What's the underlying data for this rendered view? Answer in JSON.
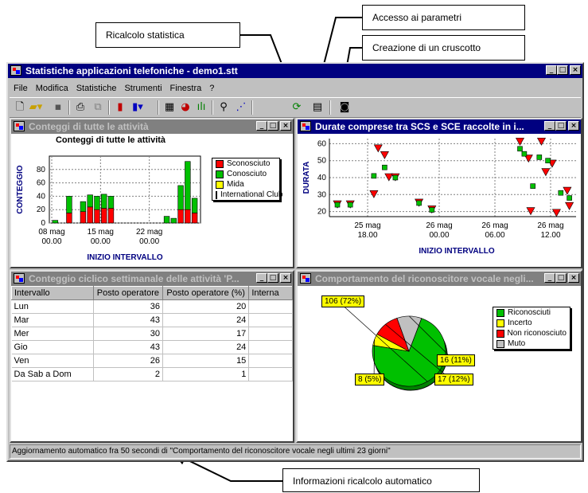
{
  "callouts": {
    "ricalcolo": "Ricalcolo statistica",
    "accesso": "Accesso ai parametri",
    "creazione": "Creazione di un cruscotto",
    "informazioni": "Informazioni ricalcolo automatico"
  },
  "app": {
    "title": "Statistiche applicazioni telefoniche - demo1.stt",
    "menu": [
      "File",
      "Modifica",
      "Statistiche",
      "Strumenti",
      "Finestra",
      "?"
    ],
    "status": "Aggiornamento automatico fra 50 secondi di \"Comportamento del riconoscitore vocale negli ultimi 23 giorni\""
  },
  "toolbar_icons": [
    "new-icon",
    "open-icon",
    "save-icon",
    "print-icon",
    "copy-icon",
    "chart-wizard-icon",
    "chart-type-icon",
    "table-icon",
    "pie-icon",
    "bar-icon",
    "zoom-icon",
    "line-icon",
    "recalc-icon",
    "parameters-icon",
    "dashboard-icon"
  ],
  "panel1": {
    "title": "Conteggi di tutte le attività",
    "chart_title": "Conteggi di tutte le attività",
    "ylabel": "CONTEGGIO",
    "xlabel": "INIZIO INTERVALLO"
  },
  "panel2": {
    "title": "Durate comprese tra SCS e SCE raccolte in i...",
    "ylabel": "DURATA",
    "xlabel": "INIZIO INTERVALLO"
  },
  "panel3": {
    "title": "Conteggio ciclico settimanale delle attività 'P...",
    "columns": [
      "Intervallo",
      "Posto operatore",
      "Posto operatore (%)",
      "Interna"
    ],
    "rows": [
      [
        "Lun",
        "36",
        "20"
      ],
      [
        "Mar",
        "43",
        "24"
      ],
      [
        "Mer",
        "30",
        "17"
      ],
      [
        "Gio",
        "43",
        "24"
      ],
      [
        "Ven",
        "26",
        "15"
      ],
      [
        "Da Sab a Dom",
        "2",
        "1"
      ]
    ]
  },
  "panel4": {
    "title": "Comportamento del riconoscitore vocale negli..."
  },
  "chart_data": [
    {
      "type": "bar",
      "title": "Conteggi di tutte le attività",
      "xlabel": "INIZIO INTERVALLO",
      "ylabel": "CONTEGGIO",
      "ylim": [
        0,
        100
      ],
      "yticks": [
        0,
        20,
        40,
        60,
        80
      ],
      "xticks": [
        [
          "08 mag",
          "00.00"
        ],
        [
          "15 mag",
          "00.00"
        ],
        [
          "22 mag",
          "00.00"
        ]
      ],
      "legend": [
        {
          "name": "Sconosciuto",
          "color": "#ff0000"
        },
        {
          "name": "Conosciuto",
          "color": "#00c000"
        },
        {
          "name": "Mida",
          "color": "#ffff00"
        },
        {
          "name": "International Club",
          "color": "#0000ff"
        }
      ],
      "series": [
        {
          "name": "Sconosciuto",
          "values": [
            0,
            0,
            15,
            0,
            17,
            24,
            20,
            22,
            22,
            0,
            0,
            0,
            0,
            0,
            0,
            0,
            0,
            0,
            20,
            20,
            15
          ]
        },
        {
          "name": "Conosciuto",
          "values": [
            4,
            0,
            25,
            0,
            15,
            18,
            20,
            21,
            18,
            0,
            0,
            0,
            0,
            0,
            0,
            0,
            10,
            7,
            36,
            72,
            22
          ]
        }
      ],
      "grid": true
    },
    {
      "type": "scatter",
      "xlabel": "INIZIO INTERVALLO",
      "ylabel": "DURATA",
      "ylim": [
        17,
        63
      ],
      "yticks": [
        20,
        30,
        40,
        50,
        60
      ],
      "xticks": [
        [
          "25 mag",
          "18.00"
        ],
        [
          "26 mag",
          "00.00"
        ],
        [
          "26 mag",
          "06.00"
        ],
        [
          "26 mag",
          "12.00"
        ]
      ],
      "series": [
        {
          "name": "green-squares",
          "color": "#00c000",
          "points": [
            [
              0.0,
              24
            ],
            [
              0.06,
              24
            ],
            [
              0.17,
              41
            ],
            [
              0.22,
              46
            ],
            [
              0.27,
              40
            ],
            [
              0.38,
              25
            ],
            [
              0.44,
              21
            ],
            [
              0.85,
              57
            ],
            [
              0.87,
              54
            ],
            [
              0.91,
              35
            ],
            [
              0.94,
              52
            ],
            [
              0.98,
              50
            ],
            [
              1.04,
              31
            ],
            [
              1.08,
              28
            ]
          ]
        },
        {
          "name": "red-triangles",
          "color": "#ff0000",
          "points": [
            [
              0.0,
              24
            ],
            [
              0.06,
              24
            ],
            [
              0.17,
              30
            ],
            [
              0.19,
              57
            ],
            [
              0.22,
              53
            ],
            [
              0.24,
              40
            ],
            [
              0.27,
              40
            ],
            [
              0.38,
              25
            ],
            [
              0.44,
              21
            ],
            [
              0.85,
              61
            ],
            [
              0.89,
              51
            ],
            [
              0.9,
              20
            ],
            [
              0.95,
              61
            ],
            [
              0.97,
              43
            ],
            [
              1.0,
              48
            ],
            [
              1.02,
              19
            ],
            [
              1.07,
              32
            ],
            [
              1.08,
              23
            ]
          ]
        }
      ],
      "grid": true
    },
    {
      "type": "pie",
      "legend": [
        {
          "name": "Riconosciuti",
          "color": "#00c000"
        },
        {
          "name": "Incerto",
          "color": "#ffff00"
        },
        {
          "name": "Non riconosciuto",
          "color": "#ff0000"
        },
        {
          "name": "Muto",
          "color": "#c0c0c0"
        }
      ],
      "values": [
        106,
        8,
        17,
        16
      ],
      "labels": [
        "106 (72%)",
        "8 (5%)",
        "17 (12%)",
        "16 (11%)"
      ]
    }
  ]
}
